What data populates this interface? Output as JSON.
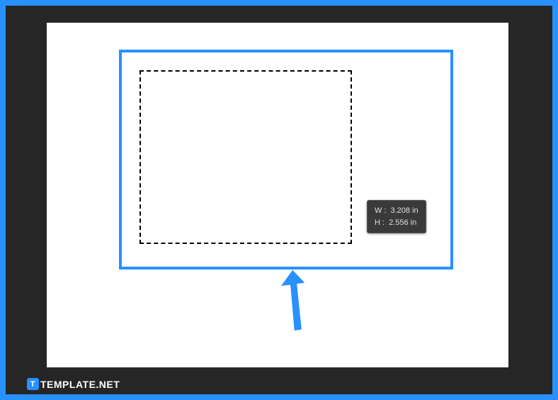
{
  "tooltip": {
    "width_label": "W :",
    "width_value": "3.208 in",
    "height_label": "H :",
    "height_value": "2.556 in"
  },
  "watermark": {
    "icon_letter": "T",
    "text": "TEMPLATE.NET"
  },
  "colors": {
    "accent": "#2890ff",
    "frame_bg": "#262626",
    "canvas_bg": "#ffffff",
    "tooltip_bg": "#3a3a3a",
    "tooltip_text": "#e0e0e0"
  }
}
